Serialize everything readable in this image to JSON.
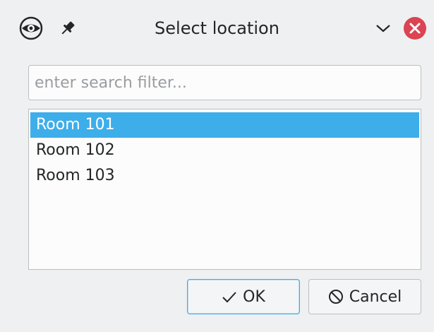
{
  "window": {
    "title": "Select location"
  },
  "titlebar_icons": {
    "app": "eye-icon",
    "pin": "pin-icon",
    "minimize": "chevron-down-icon",
    "close": "close-icon"
  },
  "search": {
    "placeholder": "enter search filter...",
    "value": ""
  },
  "locations": {
    "items": [
      {
        "label": "Room 101",
        "selected": true
      },
      {
        "label": "Room 102",
        "selected": false
      },
      {
        "label": "Room 103",
        "selected": false
      }
    ]
  },
  "buttons": {
    "ok_label": "OK",
    "cancel_label": "Cancel"
  },
  "colors": {
    "accent": "#3daee9",
    "close": "#da4453",
    "window_bg": "#eff0f1"
  }
}
